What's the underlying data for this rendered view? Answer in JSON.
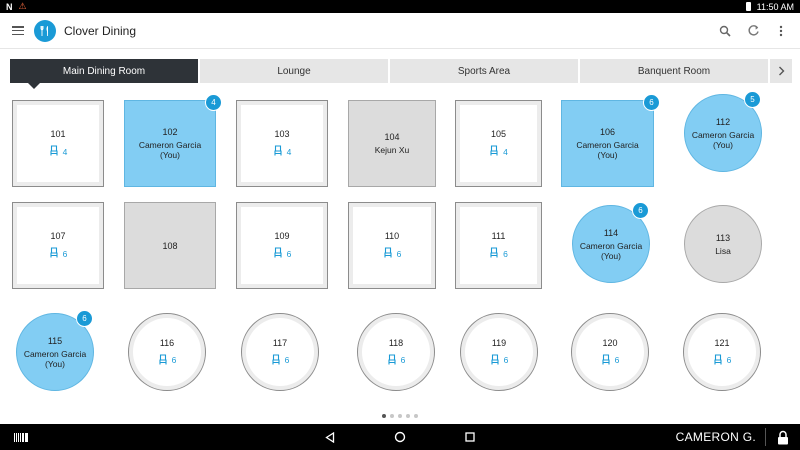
{
  "status_bar": {
    "time": "11:50 AM",
    "left_letter": "N",
    "warning_symbol": "⚠"
  },
  "app": {
    "title": "Clover Dining",
    "accent": "#1a9ad6"
  },
  "tabs": [
    {
      "label": "Main Dining Room",
      "active": true
    },
    {
      "label": "Lounge",
      "active": false
    },
    {
      "label": "Sports Area",
      "active": false
    },
    {
      "label": "Banquent Room",
      "active": false
    }
  ],
  "tables": [
    {
      "number": "101",
      "seats": "4",
      "status": "open",
      "shape": "square"
    },
    {
      "number": "102",
      "name": "Cameron Garcia (You)",
      "badge": "4",
      "status": "mine",
      "shape": "square"
    },
    {
      "number": "103",
      "seats": "4",
      "status": "open",
      "shape": "square"
    },
    {
      "number": "104",
      "name": "Kejun Xu",
      "status": "other",
      "shape": "square"
    },
    {
      "number": "105",
      "seats": "4",
      "status": "open",
      "shape": "square"
    },
    {
      "number": "106",
      "name": "Cameron Garcia (You)",
      "badge": "6",
      "status": "mine",
      "shape": "square"
    },
    {
      "number": "112",
      "name": "Cameron Garcia (You)",
      "badge": "5",
      "status": "mine",
      "shape": "round"
    },
    {
      "number": "107",
      "seats": "6",
      "status": "open",
      "shape": "square"
    },
    {
      "number": "108",
      "status": "other",
      "shape": "square"
    },
    {
      "number": "109",
      "seats": "6",
      "status": "open",
      "shape": "square"
    },
    {
      "number": "110",
      "seats": "6",
      "status": "open",
      "shape": "square"
    },
    {
      "number": "111",
      "seats": "6",
      "status": "open",
      "shape": "square"
    },
    {
      "number": "114",
      "name": "Cameron Garcia (You)",
      "badge": "6",
      "status": "mine",
      "shape": "round"
    },
    {
      "number": "113",
      "name": "Lisa",
      "status": "other",
      "shape": "round"
    },
    {
      "number": "115",
      "name": "Cameron Garcia (You)",
      "badge": "6",
      "status": "mine",
      "shape": "round"
    },
    {
      "number": "116",
      "seats": "6",
      "status": "open",
      "shape": "round"
    },
    {
      "number": "117",
      "seats": "6",
      "status": "open",
      "shape": "round"
    },
    {
      "number": "118",
      "seats": "6",
      "status": "open",
      "shape": "round"
    },
    {
      "number": "119",
      "seats": "6",
      "status": "open",
      "shape": "round"
    },
    {
      "number": "120",
      "seats": "6",
      "status": "open",
      "shape": "round"
    },
    {
      "number": "121",
      "seats": "6",
      "status": "open",
      "shape": "round"
    }
  ],
  "pagination": {
    "pages": 5,
    "current": 1
  },
  "nav": {
    "user_label": "CAMERON G."
  }
}
